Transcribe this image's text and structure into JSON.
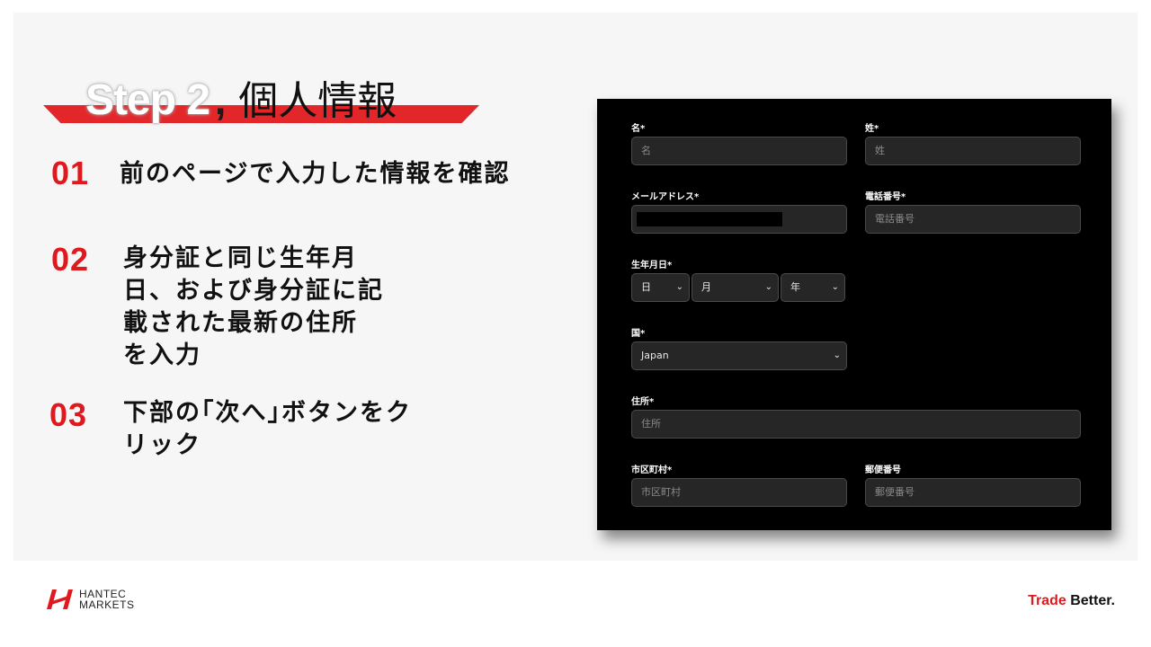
{
  "title": {
    "step": "Step 2",
    "comma": ",",
    "subtitle": "個人情報"
  },
  "steps": [
    {
      "num": "01",
      "text": "前のページで入力した情報を確認"
    },
    {
      "num": "02",
      "text": "身分証と同じ生年月\n日、および身分証に記\n載された最新の住所\nを入力"
    },
    {
      "num": "03",
      "text": "下部の｢次へ｣ボタンをク\nリック"
    }
  ],
  "form": {
    "first_name": {
      "label": "名*",
      "placeholder": "名"
    },
    "last_name": {
      "label": "姓*",
      "placeholder": "姓"
    },
    "email": {
      "label": "メールアドレス*",
      "value": ""
    },
    "phone": {
      "label": "電話番号*",
      "placeholder": "電話番号"
    },
    "dob": {
      "label": "生年月日*",
      "day": "日",
      "month": "月",
      "year": "年"
    },
    "country": {
      "label": "国*",
      "value": "Japan"
    },
    "address": {
      "label": "住所*",
      "placeholder": "住所"
    },
    "city": {
      "label": "市区町村*",
      "placeholder": "市区町村"
    },
    "postal": {
      "label": "郵便番号",
      "placeholder": "郵便番号"
    }
  },
  "footer": {
    "logo_line1": "HANTEC",
    "logo_line2": "MARKETS",
    "tagline_red": "Trade",
    "tagline_dark": "Better."
  },
  "colors": {
    "accent_red": "#e0191f",
    "form_bg": "#000000",
    "input_bg": "#262626",
    "slide_bg": "#f6f6f6"
  }
}
